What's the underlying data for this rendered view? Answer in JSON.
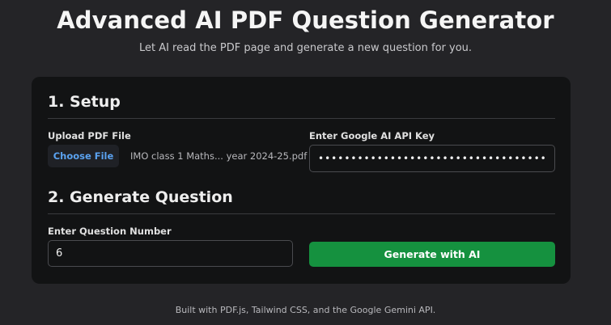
{
  "header": {
    "title": "Advanced AI PDF Question Generator",
    "subtitle": "Let AI read the PDF page and generate a new question for you."
  },
  "setup": {
    "section_title": "1. Setup",
    "upload_label": "Upload PDF File",
    "choose_button_label": "Choose File",
    "file_name": "IMO class 1 Maths... year 2024-25.pdf",
    "api_key_label": "Enter Google AI API Key",
    "api_key_value": "••••••••••••••••••••••••••••••••••••••"
  },
  "generate": {
    "section_title": "2. Generate Question",
    "question_number_label": "Enter Question Number",
    "question_number_value": "6",
    "generate_button_label": "Generate with AI"
  },
  "footer": {
    "text": "Built with PDF.js, Tailwind CSS, and the Google Gemini API."
  },
  "colors": {
    "page_background": "#242427",
    "card_background": "#121314",
    "accent_green": "#15913f",
    "link_blue": "#5aa2f0"
  }
}
